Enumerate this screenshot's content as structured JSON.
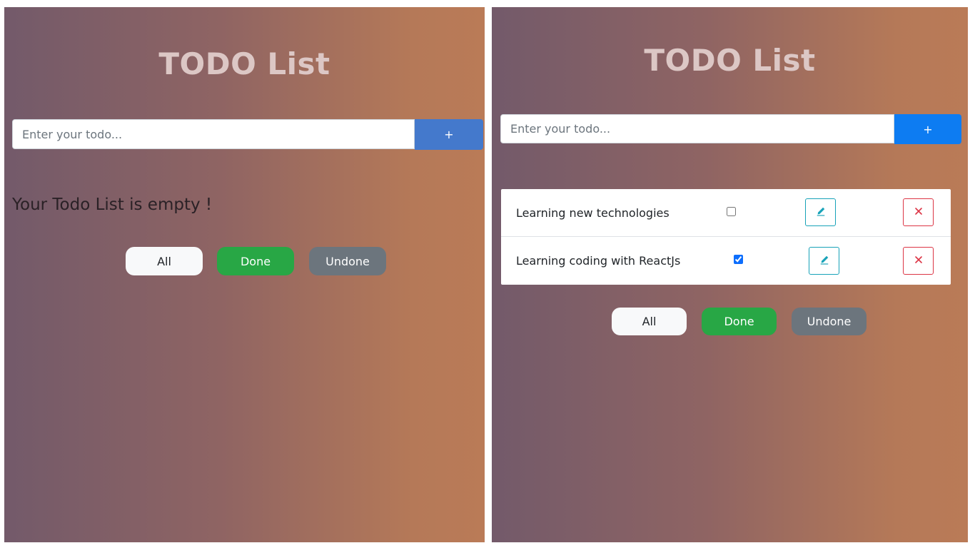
{
  "left_panel": {
    "title": "TODO List",
    "input": {
      "placeholder": "Enter your todo...",
      "value": ""
    },
    "add_label": "+",
    "empty_message": "Your Todo List is empty !",
    "filters": {
      "all": "All",
      "done": "Done",
      "undone": "Undone"
    }
  },
  "right_panel": {
    "title": "TODO List",
    "input": {
      "placeholder": "Enter your todo...",
      "value": ""
    },
    "add_label": "+",
    "todos": [
      {
        "text": "Learning new technologies",
        "done": false,
        "edit_icon": "pencil-icon",
        "delete_icon": "close-icon"
      },
      {
        "text": "Learning coding with ReactJs",
        "done": true,
        "edit_icon": "pencil-icon",
        "delete_icon": "close-icon"
      }
    ],
    "filters": {
      "all": "All",
      "done": "Done",
      "undone": "Undone"
    }
  },
  "colors": {
    "primary": "#0d7cf2",
    "success": "#28a745",
    "secondary": "#6c757d",
    "info": "#17a2b8",
    "danger": "#dc3545"
  }
}
